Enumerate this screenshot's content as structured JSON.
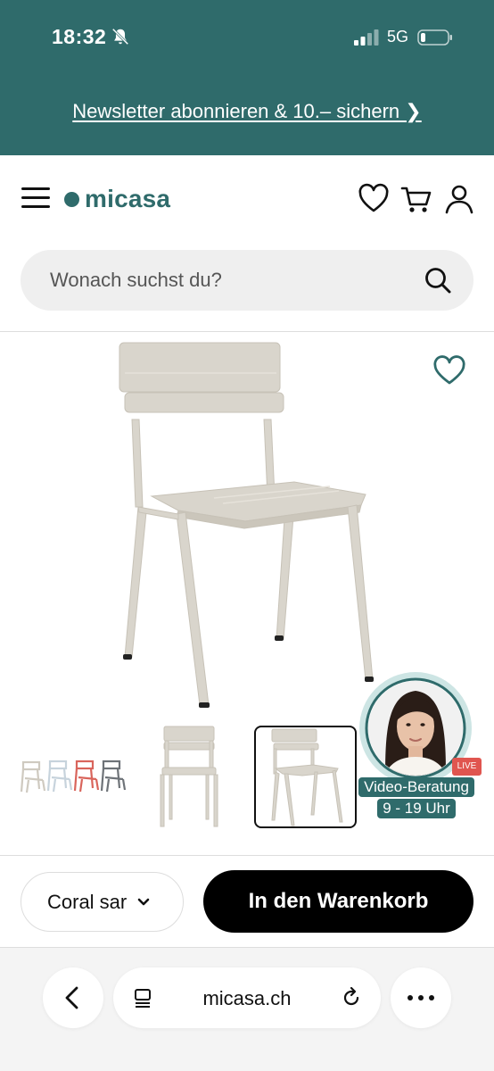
{
  "status_bar": {
    "time": "18:32",
    "network": "5G"
  },
  "promo": {
    "text": "Newsletter abonnieren & 10.– sichern ❯"
  },
  "header": {
    "logo_text": "micasa"
  },
  "search": {
    "placeholder": "Wonach suchst du?"
  },
  "advisor": {
    "badge": "LIVE",
    "label_line1": "Video-Beratung",
    "label_line2": "9 - 19 Uhr"
  },
  "actions": {
    "color_value": "Coral sar",
    "cart_label": "In den Warenkorb"
  },
  "browser": {
    "domain": "micasa.ch"
  },
  "colors": {
    "brand_teal": "#2f6b6b",
    "chair_beige": "#d9d5cc",
    "live_red": "#e0554f"
  }
}
